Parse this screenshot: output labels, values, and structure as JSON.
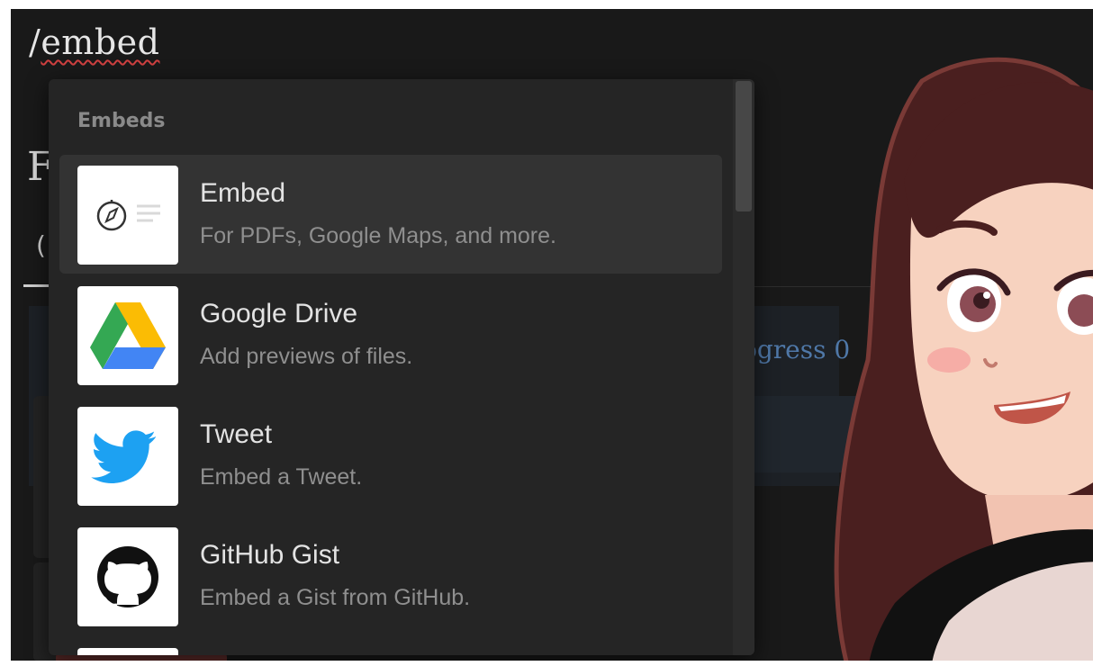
{
  "editor": {
    "slash_prefix": "/",
    "command_word": "embed"
  },
  "background": {
    "heading_char": "F",
    "paren_char": "(",
    "progress_text": "ogress 0"
  },
  "menu": {
    "header": "Embeds",
    "items": [
      {
        "title": "Embed",
        "desc": "For PDFs, Google Maps, and more.",
        "icon": "compass-icon",
        "selected": true
      },
      {
        "title": "Google Drive",
        "desc": "Add previews of files.",
        "icon": "google-drive-icon",
        "selected": false
      },
      {
        "title": "Tweet",
        "desc": "Embed a Tweet.",
        "icon": "twitter-bird-icon",
        "selected": false
      },
      {
        "title": "GitHub Gist",
        "desc": "Embed a Gist from GitHub.",
        "icon": "github-icon",
        "selected": false
      }
    ]
  },
  "colors": {
    "app_bg": "#191919",
    "menu_bg": "#252525",
    "selected_bg": "#333333",
    "twitter_blue": "#1DA1F2",
    "drive_yellow": "#FBBC04",
    "drive_green": "#34A853",
    "drive_blue": "#4285F4"
  }
}
